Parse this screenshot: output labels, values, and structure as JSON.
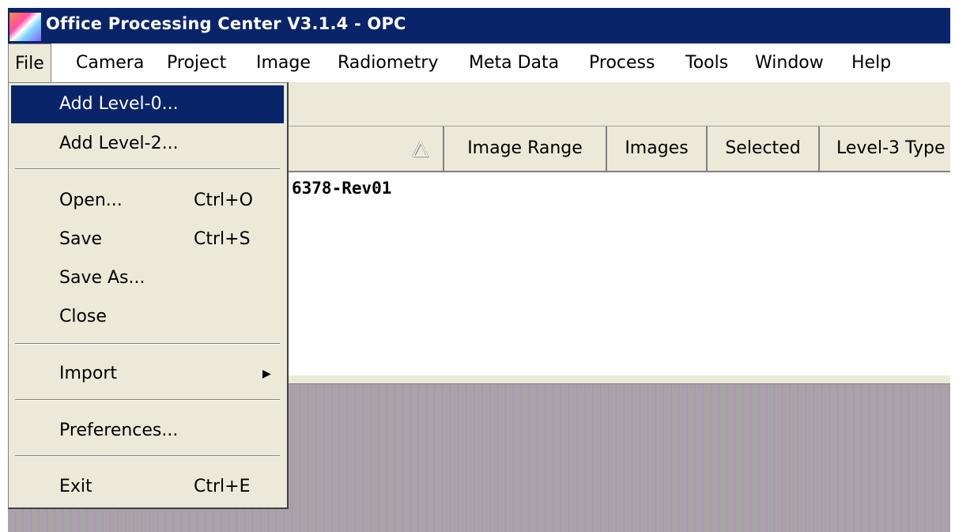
{
  "window": {
    "title": "Office Processing Center V3.1.4 - OPC",
    "icon": "opc-app-icon"
  },
  "menubar": {
    "items": [
      "File",
      "Camera",
      "Project",
      "Image",
      "Radiometry",
      "Meta Data",
      "Process",
      "Tools",
      "Window",
      "Help"
    ]
  },
  "file_menu": {
    "add_level0": "Add Level-0...",
    "add_level2": "Add Level-2...",
    "open": "Open...",
    "open_shortcut": "Ctrl+O",
    "save": "Save",
    "save_shortcut": "Ctrl+S",
    "save_as": "Save As...",
    "close": "Close",
    "import": "Import",
    "import_arrow_icon": "submenu-arrow-icon",
    "preferences": "Preferences...",
    "exit": "Exit",
    "exit_shortcut": "Ctrl+E"
  },
  "list": {
    "columns": [
      "Image Range",
      "Images",
      "Selected",
      "Level-3 Type"
    ],
    "sort_icon": "sort-ascending-icon",
    "rows": [
      {
        "name": "6378-Rev01"
      }
    ]
  },
  "colors": {
    "title_bar": "#0a246a",
    "menu_highlight": "#0a246a",
    "menu_background": "#ece9d8",
    "workspace": "#a7a3a8"
  }
}
